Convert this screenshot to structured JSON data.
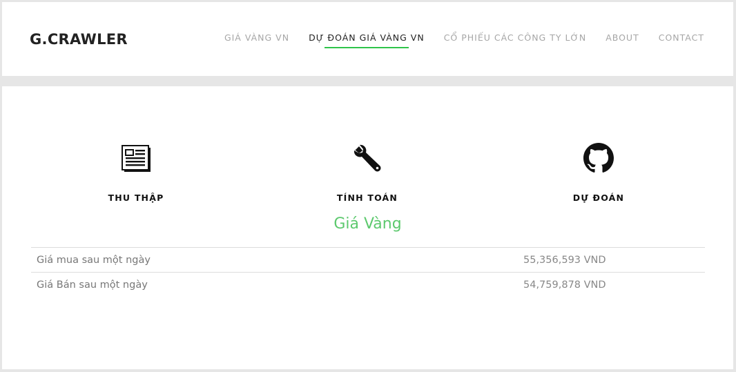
{
  "brand": "G.CRAWLER",
  "nav": [
    {
      "label": "GIÁ VÀNG VN",
      "active": false
    },
    {
      "label": "DỰ ĐOÁN GIÁ VÀNG VN",
      "active": true
    },
    {
      "label": "CỔ PHIẾU CÁC CÔNG TY LỚN",
      "active": false
    },
    {
      "label": "ABOUT",
      "active": false
    },
    {
      "label": "CONTACT",
      "active": false
    }
  ],
  "features": [
    {
      "icon": "newspaper-icon",
      "label": "THU THẬP"
    },
    {
      "icon": "wrench-icon",
      "label": "TÍNH TOÁN"
    },
    {
      "icon": "github-icon",
      "label": "DỰ ĐOÁN"
    }
  ],
  "section_title": "Giá Vàng",
  "table": {
    "rows": [
      {
        "label": "Giá mua sau một ngày",
        "value": "55,356,593 VND"
      },
      {
        "label": "Giá Bán sau một ngày",
        "value": "54,759,878 VND"
      }
    ]
  },
  "colors": {
    "accent": "#2ec44a",
    "title_green": "#5dc96e",
    "nav_inactive": "#a6a6a6"
  }
}
